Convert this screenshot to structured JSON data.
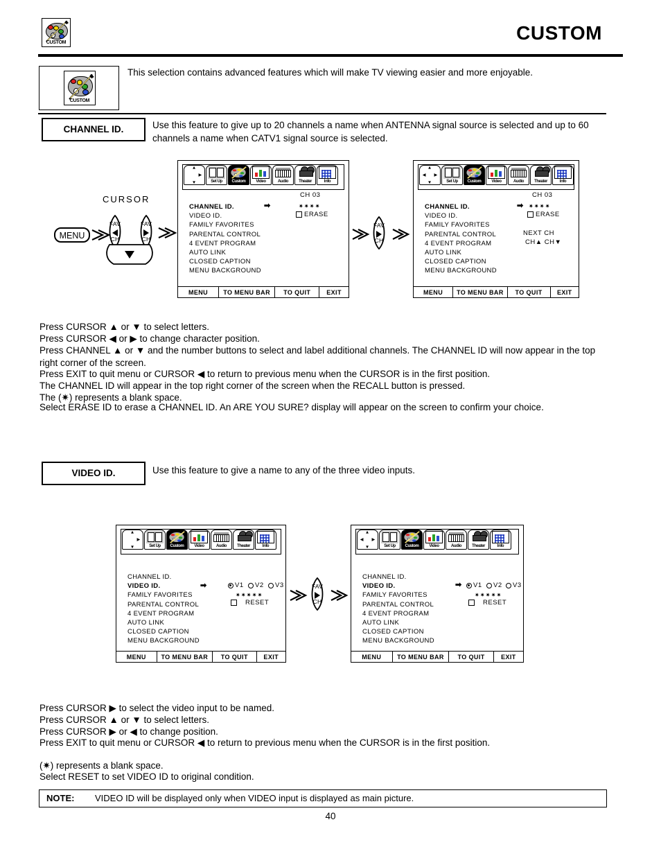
{
  "page": {
    "title": "CUSTOM",
    "page_number": "40",
    "header_icon": "custom-palette-icon",
    "header_icon_label": "CUSTOM"
  },
  "intro": {
    "icon_label": "CUSTOM",
    "description": "This selection contains advanced features which will make TV viewing easier and more enjoyable."
  },
  "sections": {
    "channel_id": {
      "label": "CHANNEL ID.",
      "description": "Use this feature to give up to 20 channels a name when ANTENNA signal source is selected and up to 60 channels a name when CATV1 signal source is selected.",
      "instructions": [
        "Press CURSOR ▲ or ▼ to select letters.",
        "Press CURSOR ◀ or ▶ to change character position.",
        "Press CHANNEL ▲ or ▼ and the number buttons to select and label additional channels.  The CHANNEL ID will now appear in the top right corner of the screen.",
        "Press EXIT to quit menu or CURSOR ◀ to return to previous menu when the CURSOR is in the first position.",
        "The CHANNEL ID will appear in the top right corner of the screen when the RECALL button is pressed.",
        "The (✷) represents a blank space.",
        "Select ERASE ID to erase a CHANNEL ID.  An  ARE YOU SURE?  display will appear on the screen to confirm your choice."
      ]
    },
    "video_id": {
      "label": "VIDEO ID.",
      "description": "Use this feature to give a name to any of the three video inputs.",
      "instructions": [
        "Press CURSOR ▶ to select the video input to be named.",
        "Press CURSOR ▲ or ▼ to select letters.",
        "Press CURSOR ▶ or ◀ to change position.",
        "Press EXIT to quit menu or CURSOR ◀ to return to previous menu when the CURSOR is in the first position.",
        "(✷) represents a blank space.",
        "Select RESET to set VIDEO ID to original condition."
      ]
    }
  },
  "remote": {
    "cursor_title": "CURSOR",
    "menu_button": "MENU",
    "fav_top": "FAV",
    "fav_bottom": "CH"
  },
  "menu_bar": {
    "icons": [
      {
        "name": "arrow-pad-icon",
        "caption": ""
      },
      {
        "name": "setup-icon",
        "caption": "Set Up"
      },
      {
        "name": "custom-icon",
        "caption": "Custom"
      },
      {
        "name": "video-icon",
        "caption": "Video"
      },
      {
        "name": "audio-icon",
        "caption": "Audio"
      },
      {
        "name": "theater-icon",
        "caption": "Theater"
      },
      {
        "name": "info-icon",
        "caption": "Info"
      }
    ],
    "selected": "Custom"
  },
  "menu_items": [
    "CHANNEL ID.",
    "VIDEO ID.",
    "FAMILY FAVORITES",
    "PARENTAL CONTROL",
    "4 EVENT PROGRAM",
    "AUTO LINK",
    "CLOSED CAPTION",
    "MENU BACKGROUND"
  ],
  "footer_buttons": [
    "MENU",
    "TO MENU BAR",
    "TO QUIT",
    "EXIT"
  ],
  "screens": {
    "channel_id_1": {
      "active_item": "CHANNEL ID.",
      "channel": "CH 03",
      "name_value": "✷✷✷✷",
      "erase_label": "ERASE"
    },
    "channel_id_2": {
      "active_item": "CHANNEL ID.",
      "channel": "CH 03",
      "name_value": "✷✷✷✷",
      "erase_label": "ERASE",
      "next_ch_label": "NEXT CH",
      "next_ch_keys": "CH▲ CH▼"
    },
    "video_id_1": {
      "active_item": "VIDEO ID.",
      "inputs": [
        "V1",
        "V2",
        "V3"
      ],
      "selected_input": "V1",
      "name_value": "✷✷✷✷✷",
      "reset_label": "RESET"
    },
    "video_id_2": {
      "active_item": "VIDEO ID.",
      "inputs": [
        "V1",
        "V2",
        "V3"
      ],
      "selected_input": "V1",
      "name_value": "✷✷✷✷✷",
      "reset_label": "RESET"
    }
  },
  "note": {
    "label": "NOTE:",
    "text": "VIDEO ID will be displayed only when VIDEO input is displayed as main picture."
  }
}
